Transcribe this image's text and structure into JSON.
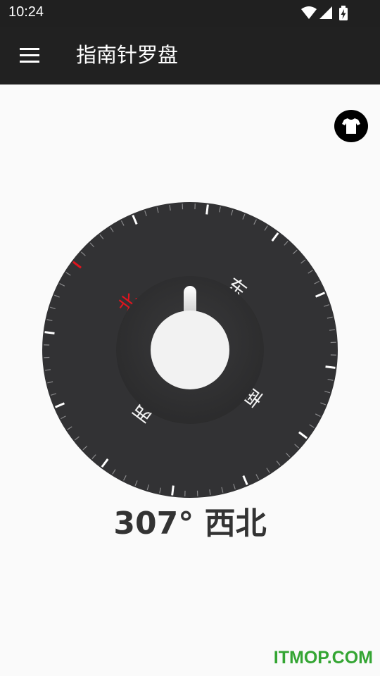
{
  "status_bar": {
    "time": "10:24",
    "icons": [
      "wifi-icon",
      "signal-icon",
      "battery-charging-icon"
    ]
  },
  "app_bar": {
    "title": "指南针罗盘",
    "menu_icon": "hamburger-menu-icon"
  },
  "skin_button": {
    "icon": "tshirt-icon"
  },
  "compass": {
    "rotation_deg": -53,
    "directions": {
      "north": "北",
      "east": "东",
      "south": "南",
      "west": "西"
    },
    "north_color": "#e0141e",
    "dial_color": "#323234",
    "knob_color": "#f2f2f2"
  },
  "heading": {
    "degrees": 307,
    "text": "307° 西北"
  },
  "watermark": "ITMOP.COM"
}
